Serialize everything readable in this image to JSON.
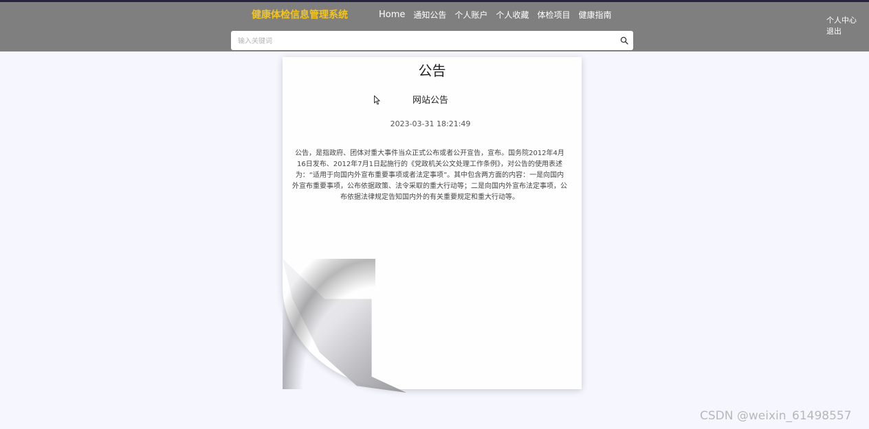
{
  "header": {
    "brand": "健康体检信息管理系统",
    "nav": [
      "Home",
      "通知公告",
      "个人账户",
      "个人收藏",
      "体检项目",
      "健康指南"
    ],
    "user_center": "个人中心",
    "logout": "退出",
    "search": {
      "placeholder": "输入关键词",
      "icon": "search-icon"
    }
  },
  "notice": {
    "heading": "公告",
    "title": "网站公告",
    "date": "2023-03-31 18:21:49",
    "content": "公告，是指政府、团体对重大事件当众正式公布或者公开宣告，宣布。国务院2012年4月16日发布、2012年7月1日起施行的《党政机关公文处理工作条例》，对公告的使用表述为：“适用于向国内外宣布重要事项或者法定事项”。其中包含两方面的内容：一是向国内外宣布重要事项，公布依据政策、法令采取的重大行动等；二是向国内外宣布法定事项，公布依据法律规定告知国内外的有关重要规定和重大行动等。"
  },
  "watermark": "CSDN @weixin_61498557",
  "colors": {
    "header_bg": "#7f7f7f",
    "brand": "#f5c518",
    "page_bg": "#f6f6fe"
  }
}
